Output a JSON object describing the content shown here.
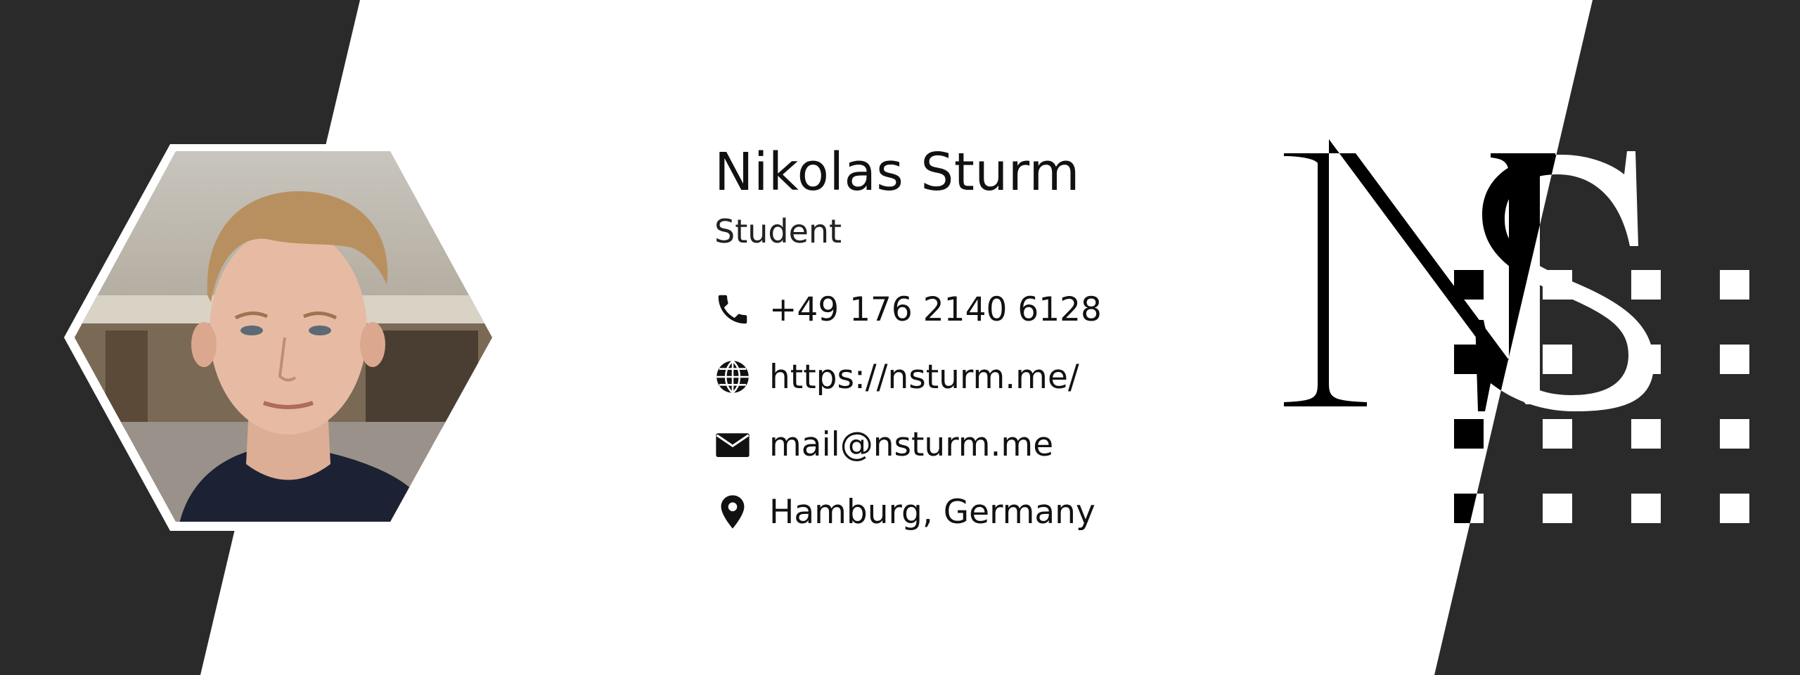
{
  "profile": {
    "name": "Nikolas Sturm",
    "title": "Student"
  },
  "contacts": [
    {
      "type": "phone",
      "icon": "phone-icon",
      "value": "+49 176 2140 6128"
    },
    {
      "type": "website",
      "icon": "globe-icon",
      "value": "https://nsturm.me/"
    },
    {
      "type": "email",
      "icon": "envelope-icon",
      "value": "mail@nsturm.me"
    },
    {
      "type": "location",
      "icon": "map-pin-icon",
      "value": "Hamburg, Germany"
    }
  ],
  "logo": {
    "letters": "NS"
  },
  "colors": {
    "background": "#ffffff",
    "dark_panel": "#2a2a2a",
    "text": "#111111"
  }
}
